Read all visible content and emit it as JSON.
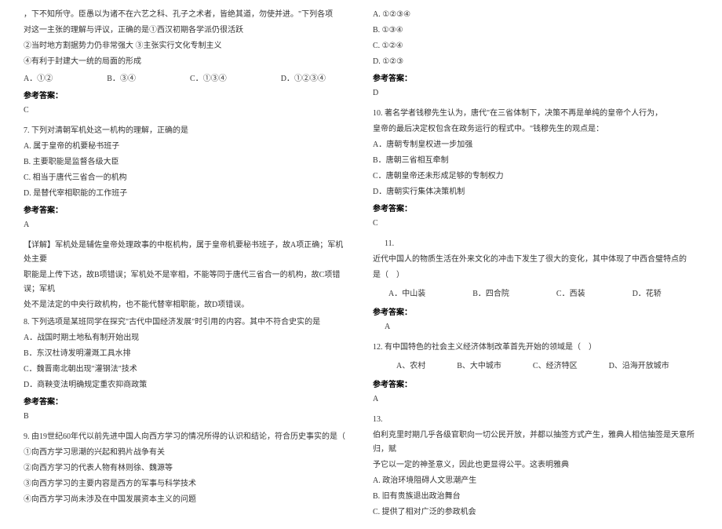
{
  "left_column": {
    "q6_intro1": "，下不知所守。臣愚以为诸不在六艺之科、孔子之术者，皆绝其道，勿使并进。\"下列各项",
    "q6_intro2": "对这一主张的理解与评议，正确的是①西汉初期各学派仍很活跃",
    "q6_opt2": "②当时地方割据势力仍非常强大 ③主张实行文化专制主义",
    "q6_opt4": "④有利于封建大一统的局面的形成",
    "q6_choices": {
      "a": "A．①②",
      "b": "B．③④",
      "c": "C．①③④",
      "d": "D．①②③④"
    },
    "answer_label": "参考答案：",
    "q6_answer": "C",
    "q7_question": "7. 下列对清朝军机处这一机构的理解，正确的是",
    "q7_a": "A. 属于皇帝的机要秘书班子",
    "q7_b": "B. 主要职能是监督各级大臣",
    "q7_c": "C. 相当于唐代三省合一的机构",
    "q7_d": "D. 是替代宰相职能的工作班子",
    "q7_answer": "A",
    "q7_explain1": "【详解】军机处是辅佐皇帝处理政事的中枢机构，属于皇帝机要秘书班子，故A项正确；军机处主要",
    "q7_explain2": "职能是上传下达，故B项错误；军机处不是宰相，不能等同于唐代三省合一的机构，故C项错误；军机",
    "q7_explain3": "处不是法定的中央行政机构，也不能代替宰相职能，故D项错误。",
    "q8_question": "8. 下列选项是某班同学在探究\"古代中国经济发展\"时引用的内容。其中不符合史实的是",
    "q8_a": "A．战国时期土地私有制开始出现",
    "q8_b": "B．东汉杜诗发明灌溉工具水排",
    "q8_c": "C．魏晋南北朝出现\"灌钢法\"技术",
    "q8_d": "D．商鞅变法明确规定重农抑商政策",
    "q8_answer": "B",
    "q9_question": "9. 由19世纪60年代以前先进中国人向西方学习的情况所得的认识和结论，符合历史事实的是（",
    "q9_opt1": "①向西方学习思潮的兴起和鸦片战争有关",
    "q9_opt2": "②向西方学习的代表人物有林则徐、魏源等",
    "q9_opt3": "③向西方学习的主要内容是西方的军事与科学技术",
    "q9_opt4": "④向西方学习尚未涉及在中国发展资本主义的问题"
  },
  "right_column": {
    "q9_a": "A. ①②③④",
    "q9_b": "B. ①③④",
    "q9_c": "C. ①②④",
    "q9_d": "D. ①②③",
    "answer_label": "参考答案：",
    "q9_answer": "D",
    "q10_question1": "10. 著名学者钱穆先生认为，唐代\"在三省体制下，决策不再是单纯的皇帝个人行为，",
    "q10_question2": "皇帝的最后决定权包含在政务运行的程式中。\"钱穆先生的观点是：",
    "q10_a": "A．唐朝专制皇权进一步加强",
    "q10_b": "B．唐朝三省相互牵制",
    "q10_c": "C．唐朝皇帝还未形成足够的专制权力",
    "q10_d": "D．唐朝实行集体决策机制",
    "q10_answer": "C",
    "q11_num": "11.",
    "q11_question": "近代中国人的物质生活在外来文化的冲击下发生了很大的变化，其中体现了中西合璧特点的",
    "q11_question2": "是（　）",
    "q11_choices": {
      "a": "A．中山装",
      "b": "B．四合院",
      "c": "C．西装",
      "d": "D．花轿"
    },
    "q11_answer": "A",
    "q12_question": "12. 有中国特色的社会主义经济体制改革首先开始的领域是（　）",
    "q12_choices": {
      "a": "A、农村",
      "b": "B、大中城市",
      "c": "C、经济特区",
      "d": "D、沿海开放城市"
    },
    "q12_answer": "A",
    "q13_num": "13.",
    "q13_question1": "伯利克里时期几乎各级官职向一切公民开放，并都以抽签方式产生，雅典人相信抽签是天意所归，赋",
    "q13_question2": "予它以一定的神圣意义，因此也更显得公平。这表明雅典",
    "q13_a": "A. 政治环境阻碍人文思潮产生",
    "q13_b": "B. 旧有贵族退出政治舞台",
    "q13_c": "C. 提供了相对广泛的参政机会"
  }
}
